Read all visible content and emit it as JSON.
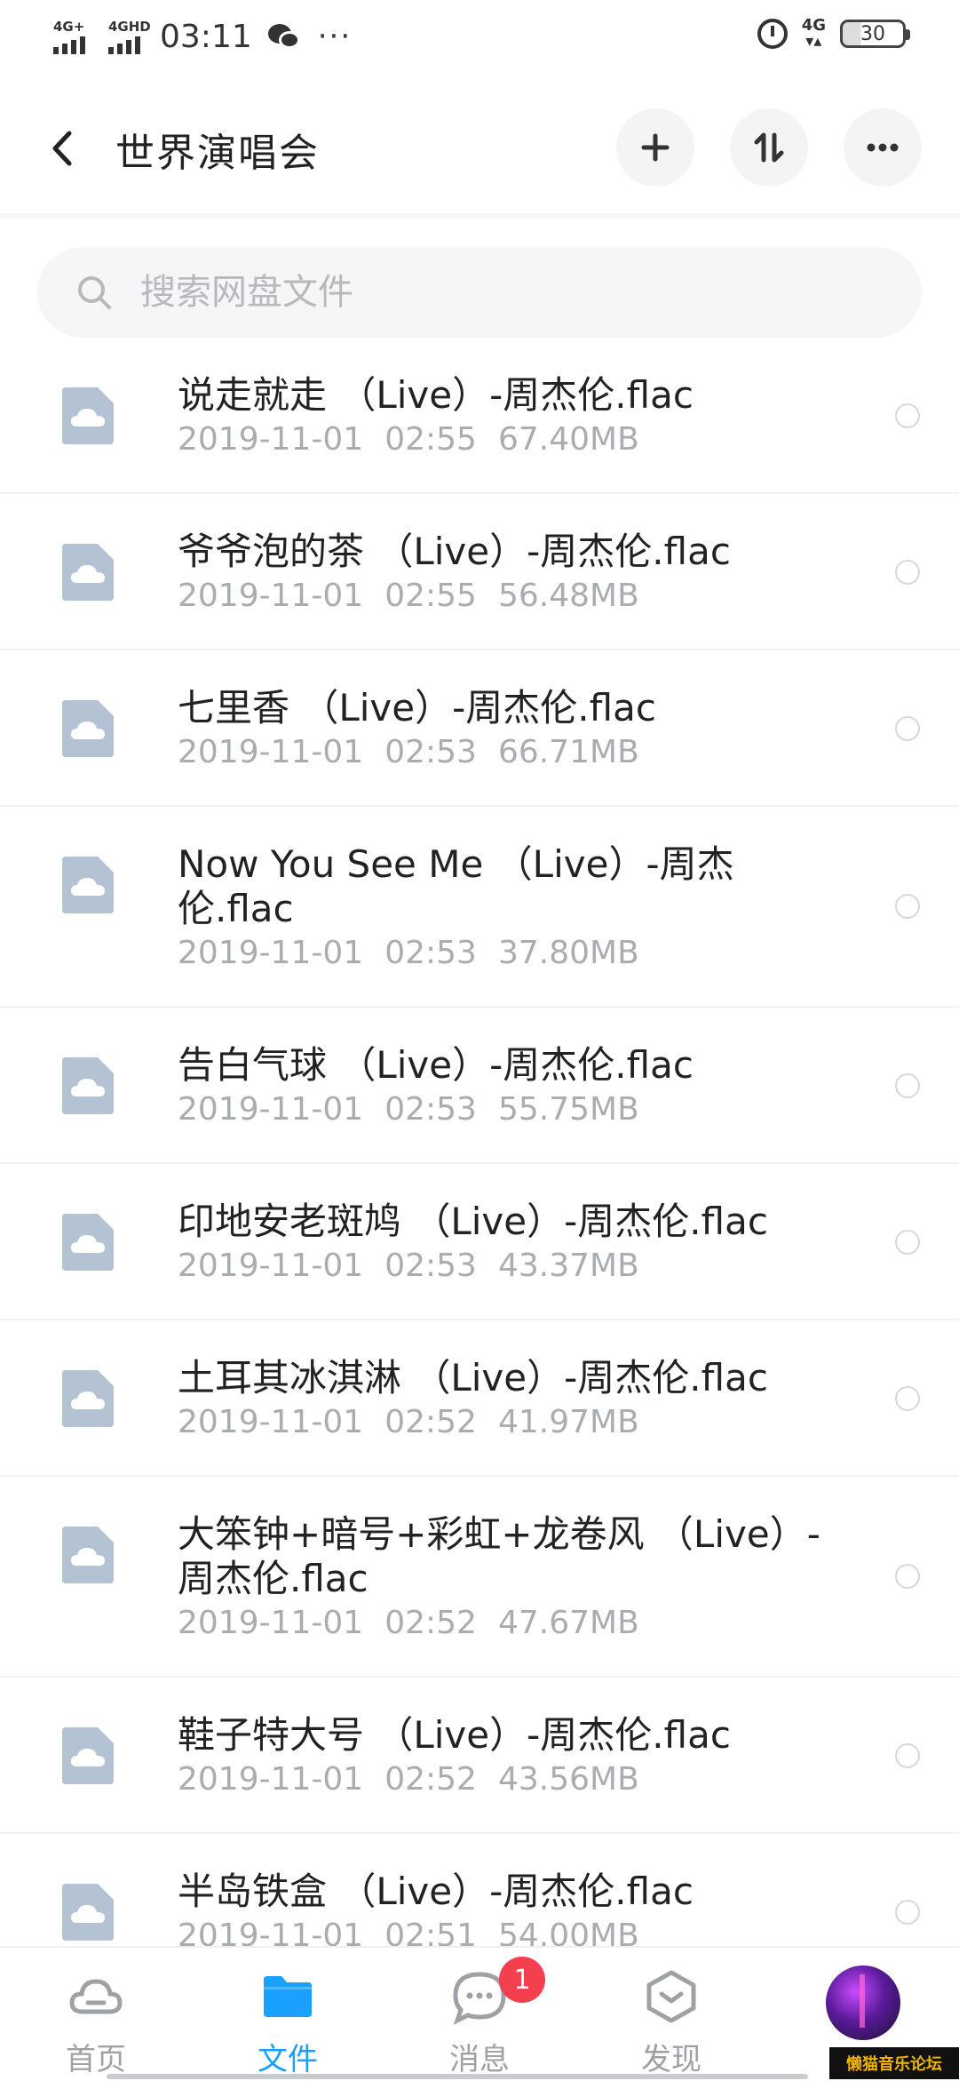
{
  "status_bar": {
    "signal1": "4G+",
    "signal2": "4GHD",
    "time": "03:11",
    "dots": "···",
    "net": "4G",
    "battery": "30"
  },
  "header": {
    "title": "世界演唱会"
  },
  "search": {
    "placeholder": "搜索网盘文件"
  },
  "files": [
    {
      "name": "说走就走 （Live）-周杰伦.flac",
      "date": "2019-11-01",
      "time": "02:55",
      "size": "67.40MB"
    },
    {
      "name": "爷爷泡的茶 （Live）-周杰伦.flac",
      "date": "2019-11-01",
      "time": "02:55",
      "size": "56.48MB"
    },
    {
      "name": "七里香 （Live）-周杰伦.flac",
      "date": "2019-11-01",
      "time": "02:53",
      "size": "66.71MB"
    },
    {
      "name": "Now You See Me （Live）-周杰伦.flac",
      "date": "2019-11-01",
      "time": "02:53",
      "size": "37.80MB"
    },
    {
      "name": "告白气球 （Live）-周杰伦.flac",
      "date": "2019-11-01",
      "time": "02:53",
      "size": "55.75MB"
    },
    {
      "name": "印地安老斑鸠 （Live）-周杰伦.flac",
      "date": "2019-11-01",
      "time": "02:53",
      "size": "43.37MB"
    },
    {
      "name": "土耳其冰淇淋 （Live）-周杰伦.flac",
      "date": "2019-11-01",
      "time": "02:52",
      "size": "41.97MB"
    },
    {
      "name": "大笨钟+暗号+彩虹+龙卷风 （Live）-周杰伦.flac",
      "date": "2019-11-01",
      "time": "02:52",
      "size": "47.67MB"
    },
    {
      "name": "鞋子特大号 （Live）-周杰伦.flac",
      "date": "2019-11-01",
      "time": "02:52",
      "size": "43.56MB"
    },
    {
      "name": "半岛铁盒 （Live）-周杰伦.flac",
      "date": "2019-11-01",
      "time": "02:51",
      "size": "54.00MB"
    }
  ],
  "tabs": [
    {
      "label": "首页",
      "icon": "cloud-icon"
    },
    {
      "label": "文件",
      "icon": "folder-icon"
    },
    {
      "label": "消息",
      "icon": "chat-icon",
      "badge": "1"
    },
    {
      "label": "发现",
      "icon": "discover-icon"
    }
  ],
  "watermark": "懒猫音乐论坛",
  "colors": {
    "accent": "#1aa0ff",
    "badge": "#f43f4e",
    "file_icon": "#b4c3d4"
  }
}
